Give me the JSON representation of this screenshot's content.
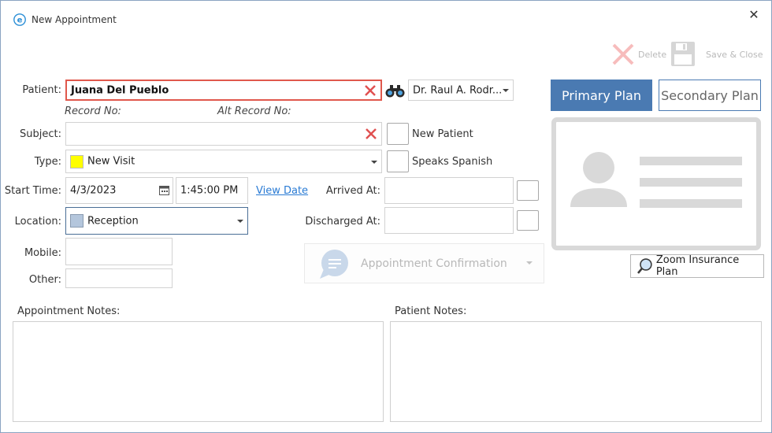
{
  "window": {
    "title": "New Appointment",
    "close_glyph": "✕"
  },
  "toolbar": {
    "delete_label": "Delete",
    "save_close_label": "Save & Close",
    "delete_icon": "x-icon",
    "save_icon": "floppy-disk-icon"
  },
  "form": {
    "patient_label": "Patient:",
    "patient_value": "Juana Del Pueblo",
    "record_no_label": "Record No:",
    "alt_record_no_label": "Alt Record No:",
    "provider_value": "Dr. Raul A. Rodr...",
    "subject_label": "Subject:",
    "subject_value": "",
    "new_patient_label": "New Patient",
    "type_label": "Type:",
    "type_value": "New Visit",
    "type_color": "#ffff00",
    "speaks_spanish_label": "Speaks Spanish",
    "start_time_label": "Start Time:",
    "start_date_value": "4/3/2023",
    "start_time_value": "1:45:00 PM",
    "view_date_label": "View Date",
    "arrived_at_label": "Arrived At:",
    "location_label": "Location:",
    "location_value": "Reception",
    "location_color": "#b4c6dc",
    "discharged_at_label": "Discharged At:",
    "mobile_label": "Mobile:",
    "other_label": "Other:",
    "confirmation_label": "Appointment Confirmation"
  },
  "insurance": {
    "primary_plan_label": "Primary Plan",
    "secondary_plan_label": "Secondary Plan",
    "zoom_label": "Zoom Insurance Plan",
    "accent_color": "#4a7ab2"
  },
  "notes": {
    "appointment_notes_label": "Appointment Notes:",
    "patient_notes_label": "Patient Notes:"
  },
  "colors": {
    "clear_red": "#e05050",
    "highlight_red": "#e0584c",
    "link_blue": "#2a7bd4"
  }
}
